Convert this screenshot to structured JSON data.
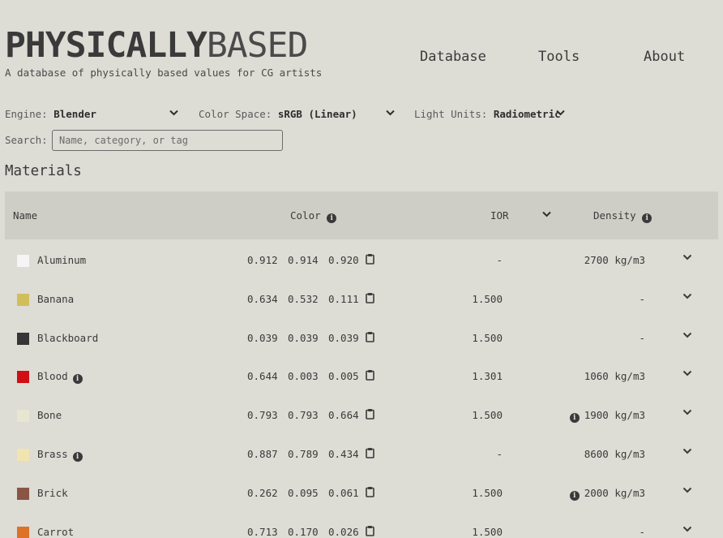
{
  "header": {
    "logo_bold": "PHYSICALLY",
    "logo_light": "BASED",
    "tagline": "A database of physically based values for CG artists"
  },
  "nav": {
    "database": "Database",
    "tools": "Tools",
    "about": "About"
  },
  "controls": {
    "engine_label": "Engine:",
    "engine_value": "Blender",
    "colorspace_label": "Color Space:",
    "colorspace_value": "sRGB (Linear)",
    "lightunits_label": "Light Units:",
    "lightunits_value": "Radiometric",
    "search_label": "Search:",
    "search_placeholder": "Name, category, or tag",
    "search_value": ""
  },
  "section_title": "Materials",
  "table": {
    "headers": {
      "name": "Name",
      "color": "Color",
      "ior": "IOR",
      "density": "Density"
    },
    "rows": [
      {
        "name": "Aluminum",
        "swatch": "#f5f5f5",
        "info": false,
        "c1": "0.912",
        "c2": "0.914",
        "c3": "0.920",
        "ior": "-",
        "density": "2700 kg/m3",
        "density_info": false
      },
      {
        "name": "Banana",
        "swatch": "#d1be5b",
        "info": false,
        "c1": "0.634",
        "c2": "0.532",
        "c3": "0.111",
        "ior": "1.500",
        "density": "-",
        "density_info": false
      },
      {
        "name": "Blackboard",
        "swatch": "#363636",
        "info": false,
        "c1": "0.039",
        "c2": "0.039",
        "c3": "0.039",
        "ior": "1.500",
        "density": "-",
        "density_info": false
      },
      {
        "name": "Blood",
        "swatch": "#d00f15",
        "info": true,
        "c1": "0.644",
        "c2": "0.003",
        "c3": "0.005",
        "ior": "1.301",
        "density": "1060 kg/m3",
        "density_info": false
      },
      {
        "name": "Bone",
        "swatch": "#e6e6d3",
        "info": false,
        "c1": "0.793",
        "c2": "0.793",
        "c3": "0.664",
        "ior": "1.500",
        "density": "1900 kg/m3",
        "density_info": true
      },
      {
        "name": "Brass",
        "swatch": "#f1e4ae",
        "info": true,
        "c1": "0.887",
        "c2": "0.789",
        "c3": "0.434",
        "ior": "-",
        "density": "8600 kg/m3",
        "density_info": false
      },
      {
        "name": "Brick",
        "swatch": "#8a5546",
        "info": false,
        "c1": "0.262",
        "c2": "0.095",
        "c3": "0.061",
        "ior": "1.500",
        "density": "2000 kg/m3",
        "density_info": true
      },
      {
        "name": "Carrot",
        "swatch": "#dd7229",
        "info": false,
        "c1": "0.713",
        "c2": "0.170",
        "c3": "0.026",
        "ior": "1.500",
        "density": "-",
        "density_info": false
      }
    ]
  },
  "icons": {
    "info": "info-icon",
    "clipboard": "clipboard-icon",
    "expand": "chevron-down-icon"
  },
  "colors": {
    "background": "#dddcd5",
    "header_bg": "#cfcec6",
    "text": "#3a3a3a"
  }
}
